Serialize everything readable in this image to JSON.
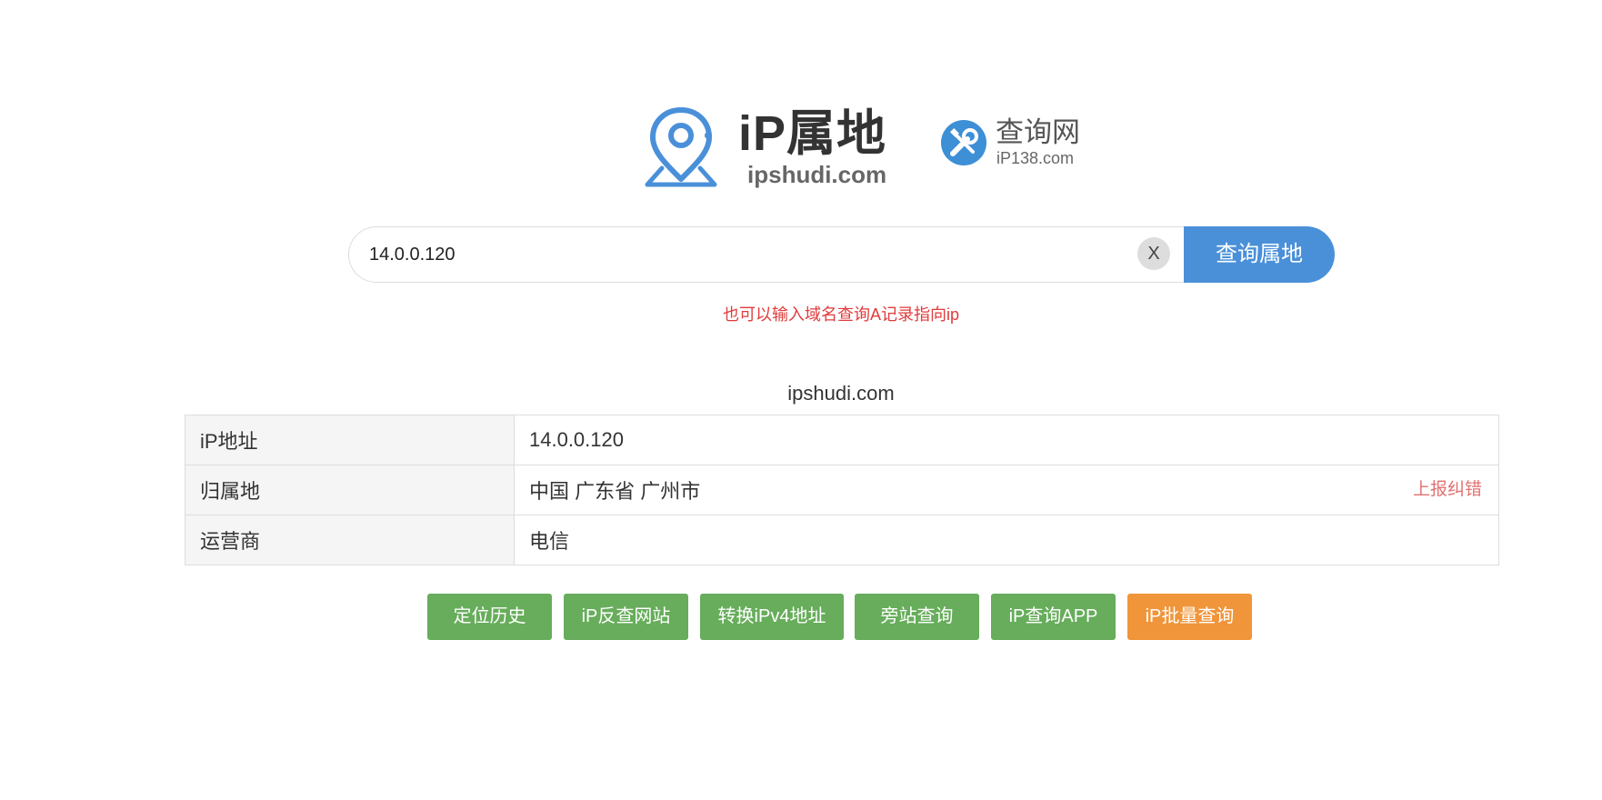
{
  "logos": {
    "main_brand": "iP属地",
    "main_domain": "ipshudi.com",
    "second_name": "查询网",
    "second_domain": "iP138.com"
  },
  "search": {
    "value": "14.0.0.120",
    "clear_label": "X",
    "button_label": "查询属地",
    "hint": "也可以输入域名查询A记录指向ip"
  },
  "result": {
    "caption": "ipshudi.com",
    "rows": [
      {
        "label": "iP地址",
        "value": "14.0.0.120"
      },
      {
        "label": "归属地",
        "value": "中国 广东省 广州市"
      },
      {
        "label": "运营商",
        "value": "电信"
      }
    ],
    "report_label": "上报纠错"
  },
  "actions": [
    {
      "label": "定位历史",
      "color": "#67ad5b"
    },
    {
      "label": "iP反查网站",
      "color": "#67ad5b"
    },
    {
      "label": "转换iPv4地址",
      "color": "#67ad5b"
    },
    {
      "label": "旁站查询",
      "color": "#67ad5b"
    },
    {
      "label": "iP查询APP",
      "color": "#67ad5b"
    },
    {
      "label": "iP批量查询",
      "color": "#f0953a"
    }
  ],
  "colors": {
    "accent_blue": "#4a90d9",
    "hint_red": "#e03b3b",
    "report_red": "#e27171",
    "button_green": "#67ad5b",
    "button_orange": "#f0953a"
  }
}
